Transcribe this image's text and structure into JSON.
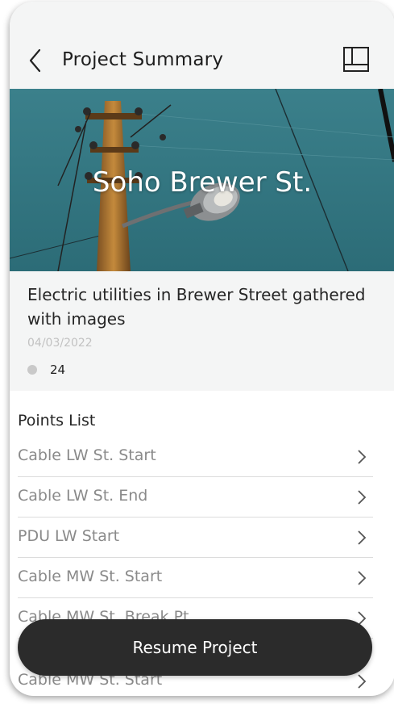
{
  "header": {
    "title": "Project Summary",
    "back_icon": "chevron-left-icon",
    "map_icon": "map-layout-icon"
  },
  "hero": {
    "title": "Soho Brewer St.",
    "image": "utility-pole-streetlight-photo"
  },
  "project": {
    "description": "Electric utilities in Brewer Street gathered with images",
    "date": "04/03/2022",
    "point_count": "24"
  },
  "points": {
    "title": "Points List",
    "items": [
      {
        "label": "Cable LW St. Start"
      },
      {
        "label": "Cable LW St. End"
      },
      {
        "label": "PDU LW Start"
      },
      {
        "label": "Cable MW St. Start"
      },
      {
        "label": "Cable MW St. Break Pt"
      },
      {
        "label": "Cable MW St. Start"
      }
    ]
  },
  "actions": {
    "resume_label": "Resume Project"
  },
  "colors": {
    "header_bg": "#f4f5f5",
    "button_bg": "#2b2b2b",
    "sky": "#3a7f8a"
  }
}
